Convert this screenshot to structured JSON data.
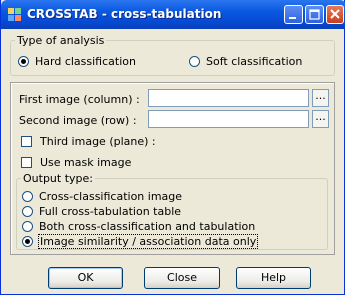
{
  "window": {
    "title": "CROSSTAB - cross-tabulation"
  },
  "analysis": {
    "legend": "Type of analysis",
    "options": [
      {
        "label": "Hard classification",
        "selected": true
      },
      {
        "label": "Soft classification",
        "selected": false
      }
    ]
  },
  "inputs": {
    "first_label": "First image (column) :",
    "first_value": "",
    "second_label": "Second image (row) :",
    "second_value": "",
    "browse_label": "...",
    "third_label": "Third image (plane) :",
    "mask_label": "Use mask image"
  },
  "output": {
    "legend": "Output type:",
    "options": [
      {
        "label": "Cross-classification image",
        "selected": false
      },
      {
        "label": "Full cross-tabulation table",
        "selected": false
      },
      {
        "label": "Both cross-classification and tabulation",
        "selected": false
      },
      {
        "label": "Image similarity / association data only",
        "selected": true
      }
    ]
  },
  "buttons": {
    "ok": "OK",
    "close": "Close",
    "help": "Help"
  },
  "colors": {
    "titlebar": "#0a58e0",
    "face": "#ece9d8",
    "close_button": "#c63f1d"
  }
}
